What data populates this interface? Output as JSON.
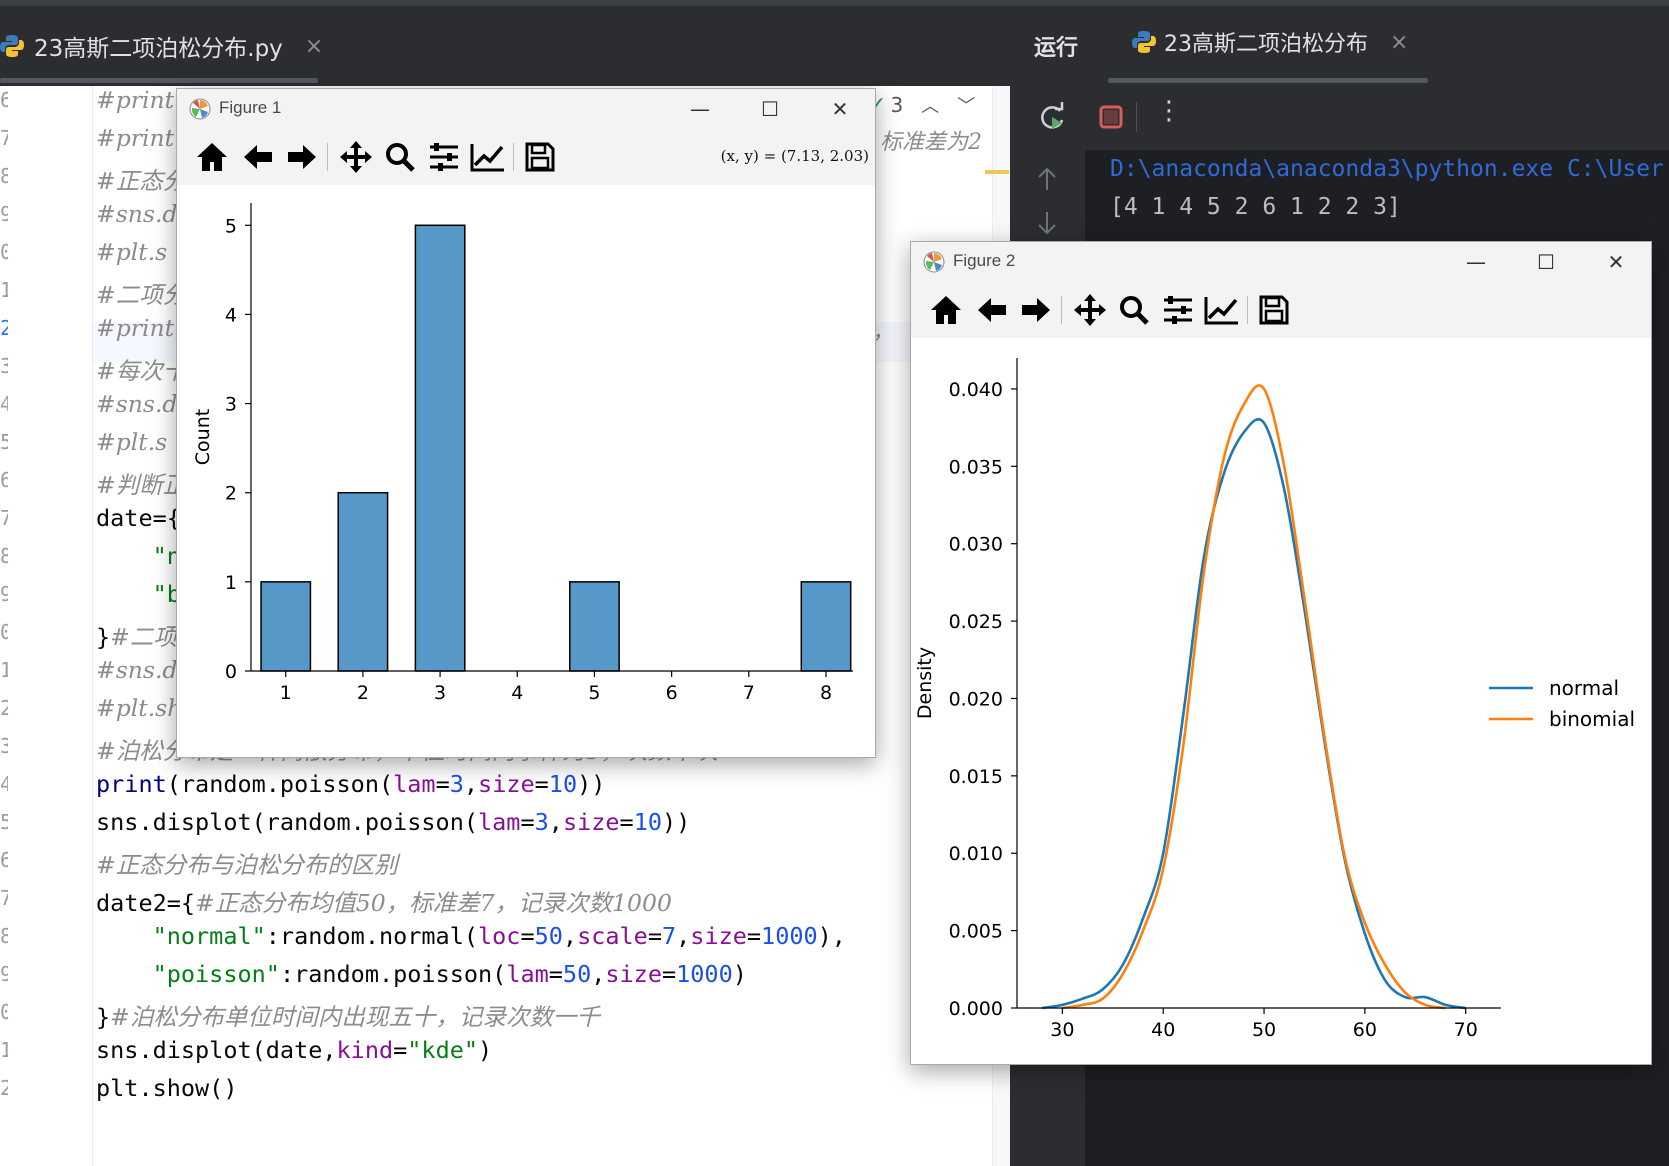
{
  "editor": {
    "tab_label": "23高斯二项泊松分布.py",
    "tab_close": "×",
    "inspection_count": "3",
    "inspection_check": "✓",
    "inspection_up": "︿",
    "inspection_down": "﹀",
    "line_numbers": [
      "6",
      "7",
      "8",
      "9",
      "0",
      "1",
      "2",
      "3",
      "4",
      "5",
      "6",
      "7",
      "8",
      "9",
      "0",
      "1",
      "2",
      "3",
      "4",
      "5",
      "6",
      "7",
      "8",
      "9",
      "0",
      "1",
      "2"
    ],
    "lines": {
      "l0": "#print",
      "l1": "#print",
      "l2": "#正态分",
      "l3": "#sns.d",
      "l4": "#plt.s",
      "l5": "#二项分",
      "l6": "#print",
      "l7": "#每次十",
      "l8": "#sns.d",
      "l9": "#plt.s",
      "l10": "#判断正",
      "l11": "date={",
      "l12": "    \"n",
      "l13": "    \"b",
      "l14a": "}",
      "l14b": "#二项",
      "l15": "#sns.d",
      "l16": "#plt.show()",
      "l17": "#泊松分布是一种离散分布，单位时间内事件为3，次数十次",
      "l18": {
        "fn": "print",
        "p1": "(random.poisson(",
        "k1": "lam",
        "e1": "=",
        "n1": "3",
        ",": ",",
        "k2": "size",
        "e2": "=",
        "n2": "10",
        "end": "))"
      },
      "l19": {
        "pre": "sns.displot(random.poisson(",
        "k1": "lam",
        "e1": "=",
        "n1": "3",
        "c": ",",
        "k2": "size",
        "e2": "=",
        "n2": "10",
        "end": "))"
      },
      "l20": "#正态分布与泊松分布的区别",
      "l21": {
        "pre": "date2={",
        "cm": "#正态分布均值50，标准差7，记录次数1000"
      },
      "l22": {
        "indent": "    ",
        "s": "\"normal\"",
        "p": ":random.normal(",
        "k1": "loc",
        "e1": "=",
        "n1": "50",
        "c1": ",",
        "k2": "scale",
        "e2": "=",
        "n2": "7",
        "c2": ",",
        "k3": "size",
        "e3": "=",
        "n3": "1000",
        "end": "),"
      },
      "l23": {
        "indent": "    ",
        "s": "\"poisson\"",
        "p": ":random.poisson(",
        "k1": "lam",
        "e1": "=",
        "n1": "50",
        "c1": ",",
        "k2": "size",
        "e2": "=",
        "n2": "1000",
        "end": ")"
      },
      "l24": {
        "pre": "}",
        "cm": "#泊松分布单位时间内出现五十，记录次数一千"
      },
      "l25": {
        "pre": "sns.displot(date,",
        "k": "kind",
        "e": "=",
        "s": "\"kde\"",
        "end": ")"
      },
      "l26": "plt.show()",
      "right_fragment_1": "标准差为2",
      "right_fragment_2": "，"
    }
  },
  "run_panel": {
    "title": "运行",
    "tab_label": "23高斯二项泊松分布",
    "tab_close": "×",
    "console_lines": [
      "D:\\anaconda\\anaconda3\\python.exe C:\\User",
      "[4 1 4 5 2 6 1 2 2 3]"
    ],
    "menu_glyph": "⋮"
  },
  "figure1": {
    "title": "Figure 1",
    "coord_readout": "(x, y) = (7.13, 2.03)",
    "minimize": "—",
    "maximize": "☐",
    "close": "✕"
  },
  "figure2": {
    "title": "Figure 2",
    "minimize": "—",
    "maximize": "☐",
    "close": "✕"
  },
  "colors": {
    "bar_fill": "#5699c8",
    "normal": "#1f77b4",
    "binomial": "#ff7f0e"
  },
  "chart_data": [
    {
      "type": "bar",
      "x": [
        1,
        2,
        3,
        5,
        8
      ],
      "values": [
        1,
        2,
        5,
        1,
        1
      ],
      "bin_width": 0.64,
      "xticks": [
        "1",
        "2",
        "3",
        "4",
        "5",
        "6",
        "7",
        "8"
      ],
      "yticks": [
        "0",
        "1",
        "2",
        "3",
        "4",
        "5"
      ],
      "xlim": [
        0.55,
        8.35
      ],
      "ylim": [
        0,
        5.25
      ],
      "xlabel": "",
      "ylabel": "Count",
      "title": ""
    },
    {
      "type": "line",
      "xticks": [
        "30",
        "40",
        "50",
        "60",
        "70"
      ],
      "yticks": [
        "0.000",
        "0.005",
        "0.010",
        "0.015",
        "0.020",
        "0.025",
        "0.030",
        "0.035",
        "0.040"
      ],
      "xlim": [
        25.5,
        73.5
      ],
      "ylim": [
        0,
        0.042
      ],
      "xlabel": "",
      "ylabel": "Density",
      "title": "",
      "legend_position": "center-right",
      "series": [
        {
          "name": "normal",
          "x": [
            28,
            30,
            32,
            34,
            36,
            38,
            40,
            42,
            44,
            46,
            48,
            50,
            52,
            54,
            56,
            58,
            60,
            62,
            64,
            66,
            68,
            70
          ],
          "y": [
            0.0,
            0.0002,
            0.0006,
            0.0012,
            0.0028,
            0.0058,
            0.01,
            0.019,
            0.029,
            0.0345,
            0.0372,
            0.0378,
            0.0335,
            0.0258,
            0.0172,
            0.0096,
            0.0048,
            0.0018,
            0.0007,
            0.0007,
            0.0002,
            0.0
          ]
        },
        {
          "name": "binomial",
          "x": [
            30,
            32,
            34,
            36,
            38,
            40,
            42,
            44,
            46,
            48,
            50,
            52,
            54,
            56,
            58,
            60,
            62,
            64,
            66,
            68
          ],
          "y": [
            0.0,
            0.0002,
            0.0006,
            0.0022,
            0.005,
            0.009,
            0.017,
            0.028,
            0.0355,
            0.039,
            0.04,
            0.035,
            0.0265,
            0.0175,
            0.0098,
            0.0055,
            0.0028,
            0.001,
            0.0002,
            0.0
          ]
        }
      ]
    }
  ]
}
